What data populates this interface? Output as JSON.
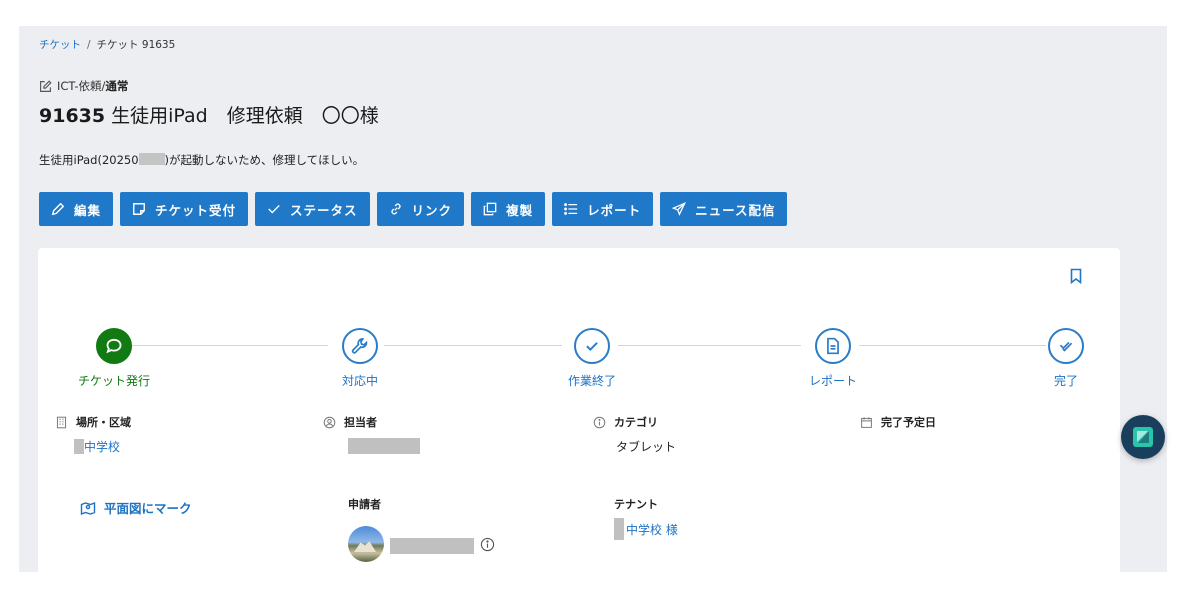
{
  "breadcrumb": {
    "root": "チケット",
    "separator": "/",
    "current": "チケット 91635"
  },
  "ticket": {
    "category_prefix": "ICT-依頼/",
    "category_priority": "通常",
    "number": "91635",
    "title": "生徒用iPad　修理依頼　〇〇様",
    "description_before": "生徒用iPad(20250",
    "description_after": ")が起動しないため、修理してほしい。"
  },
  "actions": [
    {
      "label": "編集",
      "icon": "pencil-icon"
    },
    {
      "label": "チケット受付",
      "icon": "note-icon"
    },
    {
      "label": "ステータス",
      "icon": "check-icon"
    },
    {
      "label": "リンク",
      "icon": "link-icon"
    },
    {
      "label": "複製",
      "icon": "copy-icon"
    },
    {
      "label": "レポート",
      "icon": "list-icon"
    },
    {
      "label": "ニュース配信",
      "icon": "send-icon"
    }
  ],
  "steps": [
    {
      "label": "チケット発行",
      "icon": "chat-bubble-icon",
      "active": true
    },
    {
      "label": "対応中",
      "icon": "wrench-icon",
      "active": false
    },
    {
      "label": "作業終了",
      "icon": "check-icon",
      "active": false
    },
    {
      "label": "レポート",
      "icon": "document-icon",
      "active": false
    },
    {
      "label": "完了",
      "icon": "double-check-icon",
      "active": false
    }
  ],
  "fields": {
    "location": {
      "label": "場所・区域",
      "value": "中学校",
      "icon": "building-icon"
    },
    "assignee": {
      "label": "担当者",
      "icon": "user-icon"
    },
    "category": {
      "label": "カテゴリ",
      "value": "タブレット",
      "icon": "info-icon"
    },
    "due_date": {
      "label": "完了予定日",
      "icon": "calendar-icon"
    },
    "requester": {
      "label": "申請者"
    },
    "tenant": {
      "label": "テナント",
      "value": "中学校 様"
    }
  },
  "map_link": {
    "label": "平面図にマーク",
    "icon": "map-pin-icon"
  },
  "colors": {
    "primary": "#1f78c8",
    "success": "#127a13",
    "page_bg": "#eceef2",
    "fab": "#1a3f5d"
  }
}
